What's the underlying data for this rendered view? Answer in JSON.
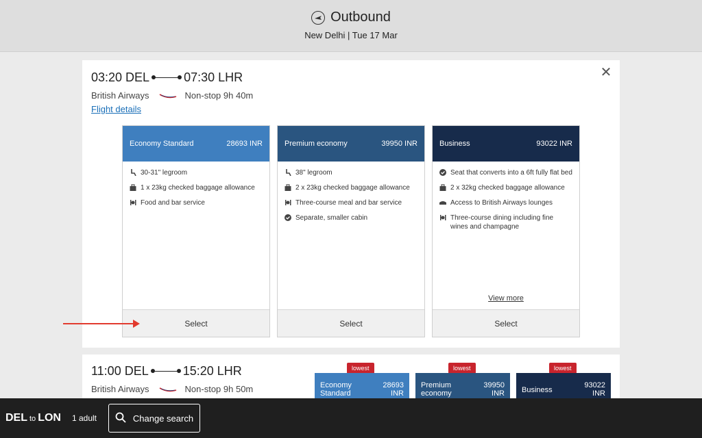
{
  "header": {
    "title": "Outbound",
    "subtitle": "New Delhi | Tue 17 Mar"
  },
  "flight1": {
    "depart": "03:20 DEL",
    "arrive": "07:30 LHR",
    "airline": "British Airways",
    "duration": "Non-stop 9h 40m",
    "details_link": "Flight details",
    "close": "✕",
    "fares": [
      {
        "name": "Economy Standard",
        "price": "28693 INR",
        "color": "#3f7fbf",
        "features": [
          "30-31\" legroom",
          "1 x 23kg checked baggage allowance",
          "Food and bar service"
        ],
        "select": "Select"
      },
      {
        "name": "Premium economy",
        "price": "39950 INR",
        "color": "#2a5580",
        "features": [
          "38\" legroom",
          "2 x 23kg checked baggage allowance",
          "Three-course meal and bar service",
          "Separate, smaller cabin"
        ],
        "select": "Select"
      },
      {
        "name": "Business",
        "price": "93022 INR",
        "color": "#172b4b",
        "features": [
          "Seat that converts into a 6ft fully flat bed",
          "2 x 32kg checked baggage allowance",
          "Access to British Airways lounges",
          "Three-course dining including fine wines and champagne"
        ],
        "view_more": "View more",
        "select": "Select"
      }
    ]
  },
  "flight2": {
    "depart": "11:00 DEL",
    "arrive": "15:20 LHR",
    "airline": "British Airways",
    "duration": "Non-stop 9h 50m",
    "badge": "lowest",
    "fares": [
      {
        "name": "Economy Standard",
        "price": "28693 INR"
      },
      {
        "name": "Premium economy",
        "price": "39950 INR"
      },
      {
        "name": "Business",
        "price": "93022 INR"
      }
    ]
  },
  "bottom_bar": {
    "from": "DEL",
    "to_word": "to",
    "to": "LON",
    "passengers": "1 adult",
    "change_search": "Change search"
  },
  "icons": {
    "plane": "airplane-icon",
    "legroom": "seat-icon",
    "baggage": "suitcase-icon",
    "food": "cutlery-icon",
    "check": "check-circle-icon",
    "lounge": "lounge-icon",
    "search": "search-icon"
  },
  "colors": {
    "accent_link": "#1a6fb8",
    "badge": "#c8242d",
    "arrow": "#e23a2e",
    "bar": "#1f1f1f"
  }
}
